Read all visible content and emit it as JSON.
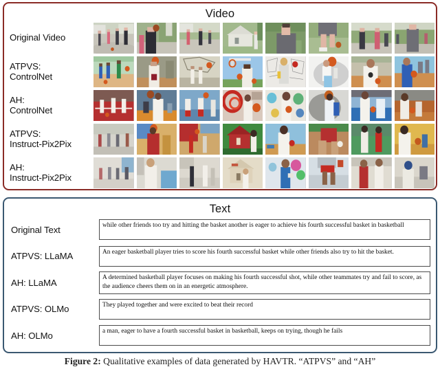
{
  "figure": {
    "caption_prefix": "Figure 2:",
    "caption_text": " Qualitative examples of data generated by HAVTR. “ATPVS” and “AH”",
    "caption_full": "Figure 2: Qualitative examples of data generated by HAVTR. “ATPVS” and “AH”"
  },
  "video_panel": {
    "title": "Video",
    "border_color": "#8a2b26",
    "frames_per_row": 8,
    "rows": [
      {
        "label": "Original Video",
        "label_lines": [
          "Original Video"
        ],
        "style": "photo-real",
        "frames": [
          "group of players on driveway court",
          "player shooting ball overhead",
          "two people standing on driveway",
          "house with person in foreground",
          "close-up man in grey shirt",
          "player bending to dribble on grass",
          "two people standing talking",
          "man in grey walking on path"
        ]
      },
      {
        "label": "ATPVS: ControlNet",
        "label_lines": [
          "ATPVS:",
          "ControlNet"
        ],
        "style": "cartoon-flat",
        "frames": [
          "indoor court with team in blue and green",
          "player in maroon jersey shooting",
          "sketch court with two players",
          "player under hoop against blue sky",
          "pencil sketch man with yellow bag",
          "two players jumping for rebound",
          "player in white tee holding ball",
          "player in blue jersey on orange court"
        ]
      },
      {
        "label": "AH: ControlNet",
        "label_lines": [
          "AH:",
          "ControlNet"
        ],
        "style": "vivid-render",
        "frames": [
          "red court with white jerseyed players",
          "player shooting over orange court",
          "two players on blue reflective court",
          "red swirl abstract with player",
          "colorful splash player holding ball",
          "grey smoke player dunking",
          "blue court player driving",
          "orange court player with ball"
        ]
      },
      {
        "label": "ATPVS: Instruct-Pix2Pix",
        "label_lines": [
          "ATPVS:",
          "Instruct-Pix2Pix"
        ],
        "style": "illustrated-warm",
        "frames": [
          "pale sketch of group on street",
          "red jersey player catching ball",
          "red barn court with two players",
          "red barn with girl in white",
          "player in white tee on sand court",
          "player bending in red jersey",
          "two players on green court",
          "yellow sky player passing ball"
        ]
      },
      {
        "label": "AH: Instruct-Pix2Pix",
        "label_lines": [
          "AH:",
          "Instruct-Pix2Pix"
        ],
        "style": "painterly-watercolor",
        "frames": [
          "watercolor group on pale street",
          "watercolor person in white top",
          "watercolor two figures on street",
          "watercolor house with figure",
          "watercolor figure with color splash",
          "watercolor figure bending over",
          "watercolor figures in red and white",
          "watercolor figure crouching"
        ]
      }
    ]
  },
  "text_panel": {
    "title": "Text",
    "border_color": "#3a5871",
    "rows": [
      {
        "label": "Original Text",
        "value": "while other friends too try and hitting the basket another is eager to achieve his fourth successful basket in basketball"
      },
      {
        "label": "ATPVS: LLaMA",
        "value": "An eager basketball player tries to score his fourth successful basket while other friends also try to hit the basket."
      },
      {
        "label": "AH: LLaMA",
        "value": "A determined basketball player focuses on making his fourth successful shot, while other teammates try and fail to score, as the audience cheers them on in an energetic atmosphere."
      },
      {
        "label": "ATPVS: OLMo",
        "value": "They played together and were excited to beat their record"
      },
      {
        "label": "AH: OLMo",
        "value": "a man, eager to have a fourth successful basket in basketball, keeps on trying, though he fails"
      }
    ]
  }
}
